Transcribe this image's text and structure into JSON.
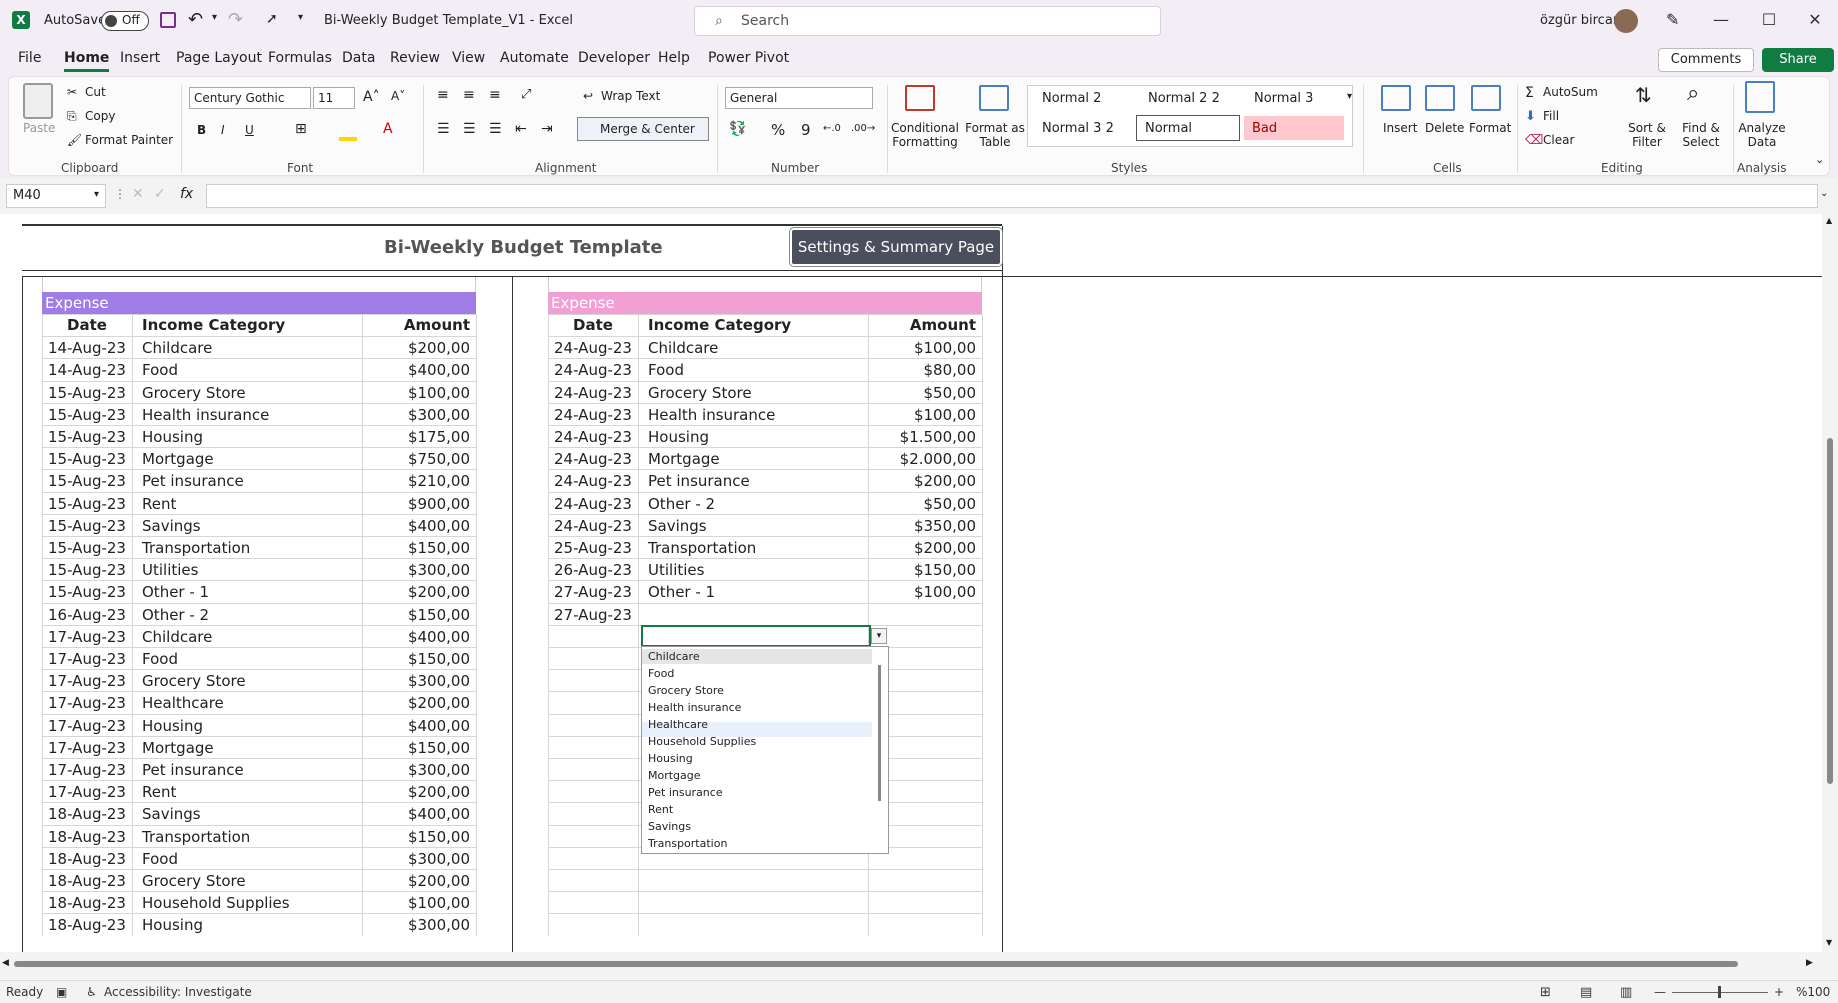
{
  "titlebar": {
    "autosave_label": "AutoSave",
    "autosave_state": "Off",
    "document_title": "Bi-Weekly Budget Template_V1  -  Excel",
    "search_placeholder": "Search",
    "user_name": "özgür bircan"
  },
  "menu": {
    "items": [
      "File",
      "Home",
      "Insert",
      "Page Layout",
      "Formulas",
      "Data",
      "Review",
      "View",
      "Automate",
      "Developer",
      "Help",
      "Power Pivot"
    ],
    "active": "Home",
    "comments_label": "Comments",
    "share_label": "Share"
  },
  "ribbon": {
    "clipboard": {
      "paste": "Paste",
      "cut": "Cut",
      "copy": "Copy",
      "format_painter": "Format Painter",
      "group": "Clipboard"
    },
    "font": {
      "name": "Century Gothic",
      "size": "11",
      "group": "Font"
    },
    "alignment": {
      "wrap_text": "Wrap Text",
      "merge_center": "Merge & Center",
      "group": "Alignment"
    },
    "number": {
      "format": "General",
      "group": "Number"
    },
    "styles": {
      "conditional": "Conditional Formatting",
      "format_table": "Format as Table",
      "cells": [
        "Normal 2",
        "Normal 2 2",
        "Normal 3",
        "Normal 3 2",
        "Normal",
        "Bad"
      ],
      "group": "Styles"
    },
    "cells": {
      "insert": "Insert",
      "delete": "Delete",
      "format": "Format",
      "group": "Cells"
    },
    "editing": {
      "autosum": "AutoSum",
      "fill": "Fill",
      "clear": "Clear",
      "sort_filter": "Sort & Filter",
      "find_select": "Find & Select",
      "group": "Editing"
    },
    "analysis": {
      "analyze": "Analyze Data",
      "group": "Analysis"
    }
  },
  "formula_bar": {
    "name_box": "M40",
    "fx": "fx",
    "value": ""
  },
  "sheet": {
    "title": "Bi-Weekly Budget Template",
    "settings_button": "Settings & Summary Page",
    "left_table": {
      "section": "Expense",
      "headers": [
        "Date",
        "Income Category",
        "Amount"
      ],
      "rows": [
        [
          "14-Aug-23",
          "Childcare",
          "$200,00"
        ],
        [
          "14-Aug-23",
          "Food",
          "$400,00"
        ],
        [
          "15-Aug-23",
          "Grocery Store",
          "$100,00"
        ],
        [
          "15-Aug-23",
          "Health insurance",
          "$300,00"
        ],
        [
          "15-Aug-23",
          "Housing",
          "$175,00"
        ],
        [
          "15-Aug-23",
          "Mortgage",
          "$750,00"
        ],
        [
          "15-Aug-23",
          "Pet insurance",
          "$210,00"
        ],
        [
          "15-Aug-23",
          "Rent",
          "$900,00"
        ],
        [
          "15-Aug-23",
          "Savings",
          "$400,00"
        ],
        [
          "15-Aug-23",
          "Transportation",
          "$150,00"
        ],
        [
          "15-Aug-23",
          "Utilities",
          "$300,00"
        ],
        [
          "15-Aug-23",
          "Other - 1",
          "$200,00"
        ],
        [
          "16-Aug-23",
          "Other - 2",
          "$150,00"
        ],
        [
          "17-Aug-23",
          "Childcare",
          "$400,00"
        ],
        [
          "17-Aug-23",
          "Food",
          "$150,00"
        ],
        [
          "17-Aug-23",
          "Grocery Store",
          "$300,00"
        ],
        [
          "17-Aug-23",
          "Healthcare",
          "$200,00"
        ],
        [
          "17-Aug-23",
          "Housing",
          "$400,00"
        ],
        [
          "17-Aug-23",
          "Mortgage",
          "$150,00"
        ],
        [
          "17-Aug-23",
          "Pet insurance",
          "$300,00"
        ],
        [
          "17-Aug-23",
          "Rent",
          "$200,00"
        ],
        [
          "18-Aug-23",
          "Savings",
          "$400,00"
        ],
        [
          "18-Aug-23",
          "Transportation",
          "$150,00"
        ],
        [
          "18-Aug-23",
          "Food",
          "$300,00"
        ],
        [
          "18-Aug-23",
          "Grocery Store",
          "$200,00"
        ],
        [
          "18-Aug-23",
          "Household Supplies",
          "$100,00"
        ],
        [
          "18-Aug-23",
          "Housing",
          "$300,00"
        ]
      ]
    },
    "right_table": {
      "section": "Expense",
      "headers": [
        "Date",
        "Income Category",
        "Amount"
      ],
      "rows": [
        [
          "24-Aug-23",
          "Childcare",
          "$100,00"
        ],
        [
          "24-Aug-23",
          "Food",
          "$80,00"
        ],
        [
          "24-Aug-23",
          "Grocery Store",
          "$50,00"
        ],
        [
          "24-Aug-23",
          "Health insurance",
          "$100,00"
        ],
        [
          "24-Aug-23",
          "Housing",
          "$1.500,00"
        ],
        [
          "24-Aug-23",
          "Mortgage",
          "$2.000,00"
        ],
        [
          "24-Aug-23",
          "Pet insurance",
          "$200,00"
        ],
        [
          "24-Aug-23",
          "Other - 2",
          "$50,00"
        ],
        [
          "24-Aug-23",
          "Savings",
          "$350,00"
        ],
        [
          "25-Aug-23",
          "Transportation",
          "$200,00"
        ],
        [
          "26-Aug-23",
          "Utilities",
          "$150,00"
        ],
        [
          "27-Aug-23",
          "Other - 1",
          "$100,00"
        ],
        [
          "27-Aug-23",
          "",
          ""
        ]
      ]
    },
    "dropdown_options": [
      "Childcare",
      "Food",
      "Grocery Store",
      "Health insurance",
      "Healthcare",
      "Household Supplies",
      "Housing",
      "Mortgage",
      "Pet insurance",
      "Rent",
      "Savings",
      "Transportation"
    ],
    "dropdown_selected": "Childcare",
    "dropdown_hover": "Healthcare"
  },
  "status": {
    "ready": "Ready",
    "accessibility": "Accessibility: Investigate",
    "zoom": "%100"
  },
  "colors": {
    "excel_green": "#107c41",
    "expense_left": "#a07de6",
    "expense_right": "#f29fd3",
    "button_dark": "#4b4e5c"
  }
}
